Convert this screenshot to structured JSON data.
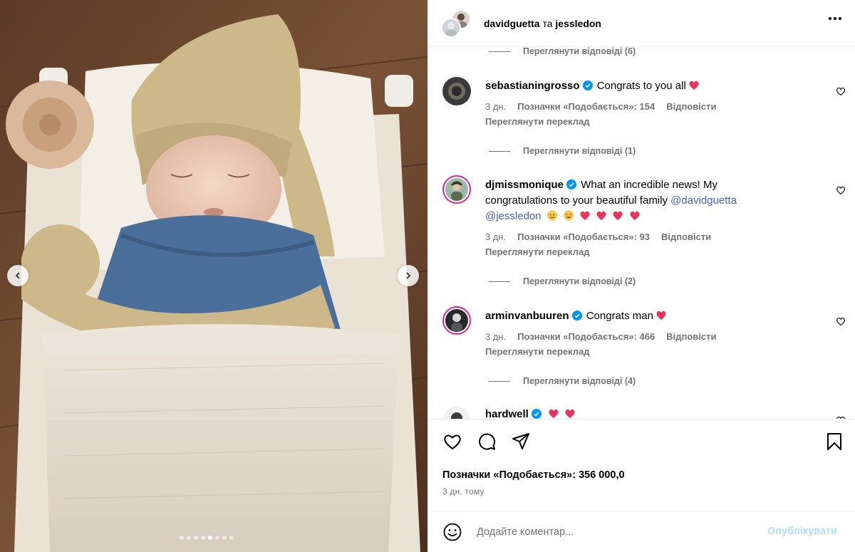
{
  "header": {
    "user1": "davidguetta",
    "separator": "та",
    "user2": "jessledon"
  },
  "replies_prefix": "Переглянути відповіді",
  "comments": [
    {
      "username": "sebastianingrosso",
      "verified": true,
      "text": "Congrats to you all",
      "age": "3 дн.",
      "likes_label": "Позначки «Подобається»: 154",
      "reply_label": "Відповісти",
      "translate_label": "Переглянути переклад",
      "replies_label": "Переглянути відповіді (1)"
    },
    {
      "username": "djmissmonique",
      "verified": true,
      "text": "What an incredible news! My congratulations to your beautiful family",
      "mention1": "@davidguetta",
      "mention2": "@jessledon",
      "age": "3 дн.",
      "likes_label": "Позначки «Подобається»: 93",
      "reply_label": "Відповісти",
      "translate_label": "Переглянути переклад",
      "replies_label": "Переглянути відповіді (2)"
    },
    {
      "username": "arminvanbuuren",
      "verified": true,
      "text": "Congrats man",
      "age": "3 дн.",
      "likes_label": "Позначки «Подобається»: 466",
      "reply_label": "Відповісти",
      "translate_label": "Переглянути переклад",
      "replies_label": "Переглянути відповіді (4)"
    },
    {
      "username": "hardwell",
      "verified": true,
      "text": ""
    }
  ],
  "top_replies_label": "Переглянути відповіді (6)",
  "post": {
    "likes_label": "Позначки «Подобається»: 356 000,0",
    "time_label": "3 дн. тому"
  },
  "compose": {
    "placeholder": "Додайте коментар...",
    "post_label": "Опублікувати"
  },
  "carousel": {
    "total_slides": 8,
    "active_slide": 5
  },
  "colors": {
    "verified": "#0095f6",
    "heart": "#ff3040",
    "post_button_disabled": "#b2dffc",
    "secondary_text": "#737373"
  },
  "icons": [
    "heart-icon",
    "comment-icon",
    "share-icon",
    "bookmark-icon",
    "emoji-icon",
    "more-icon",
    "chevron-left-icon",
    "chevron-right-icon",
    "verified-badge-icon"
  ]
}
